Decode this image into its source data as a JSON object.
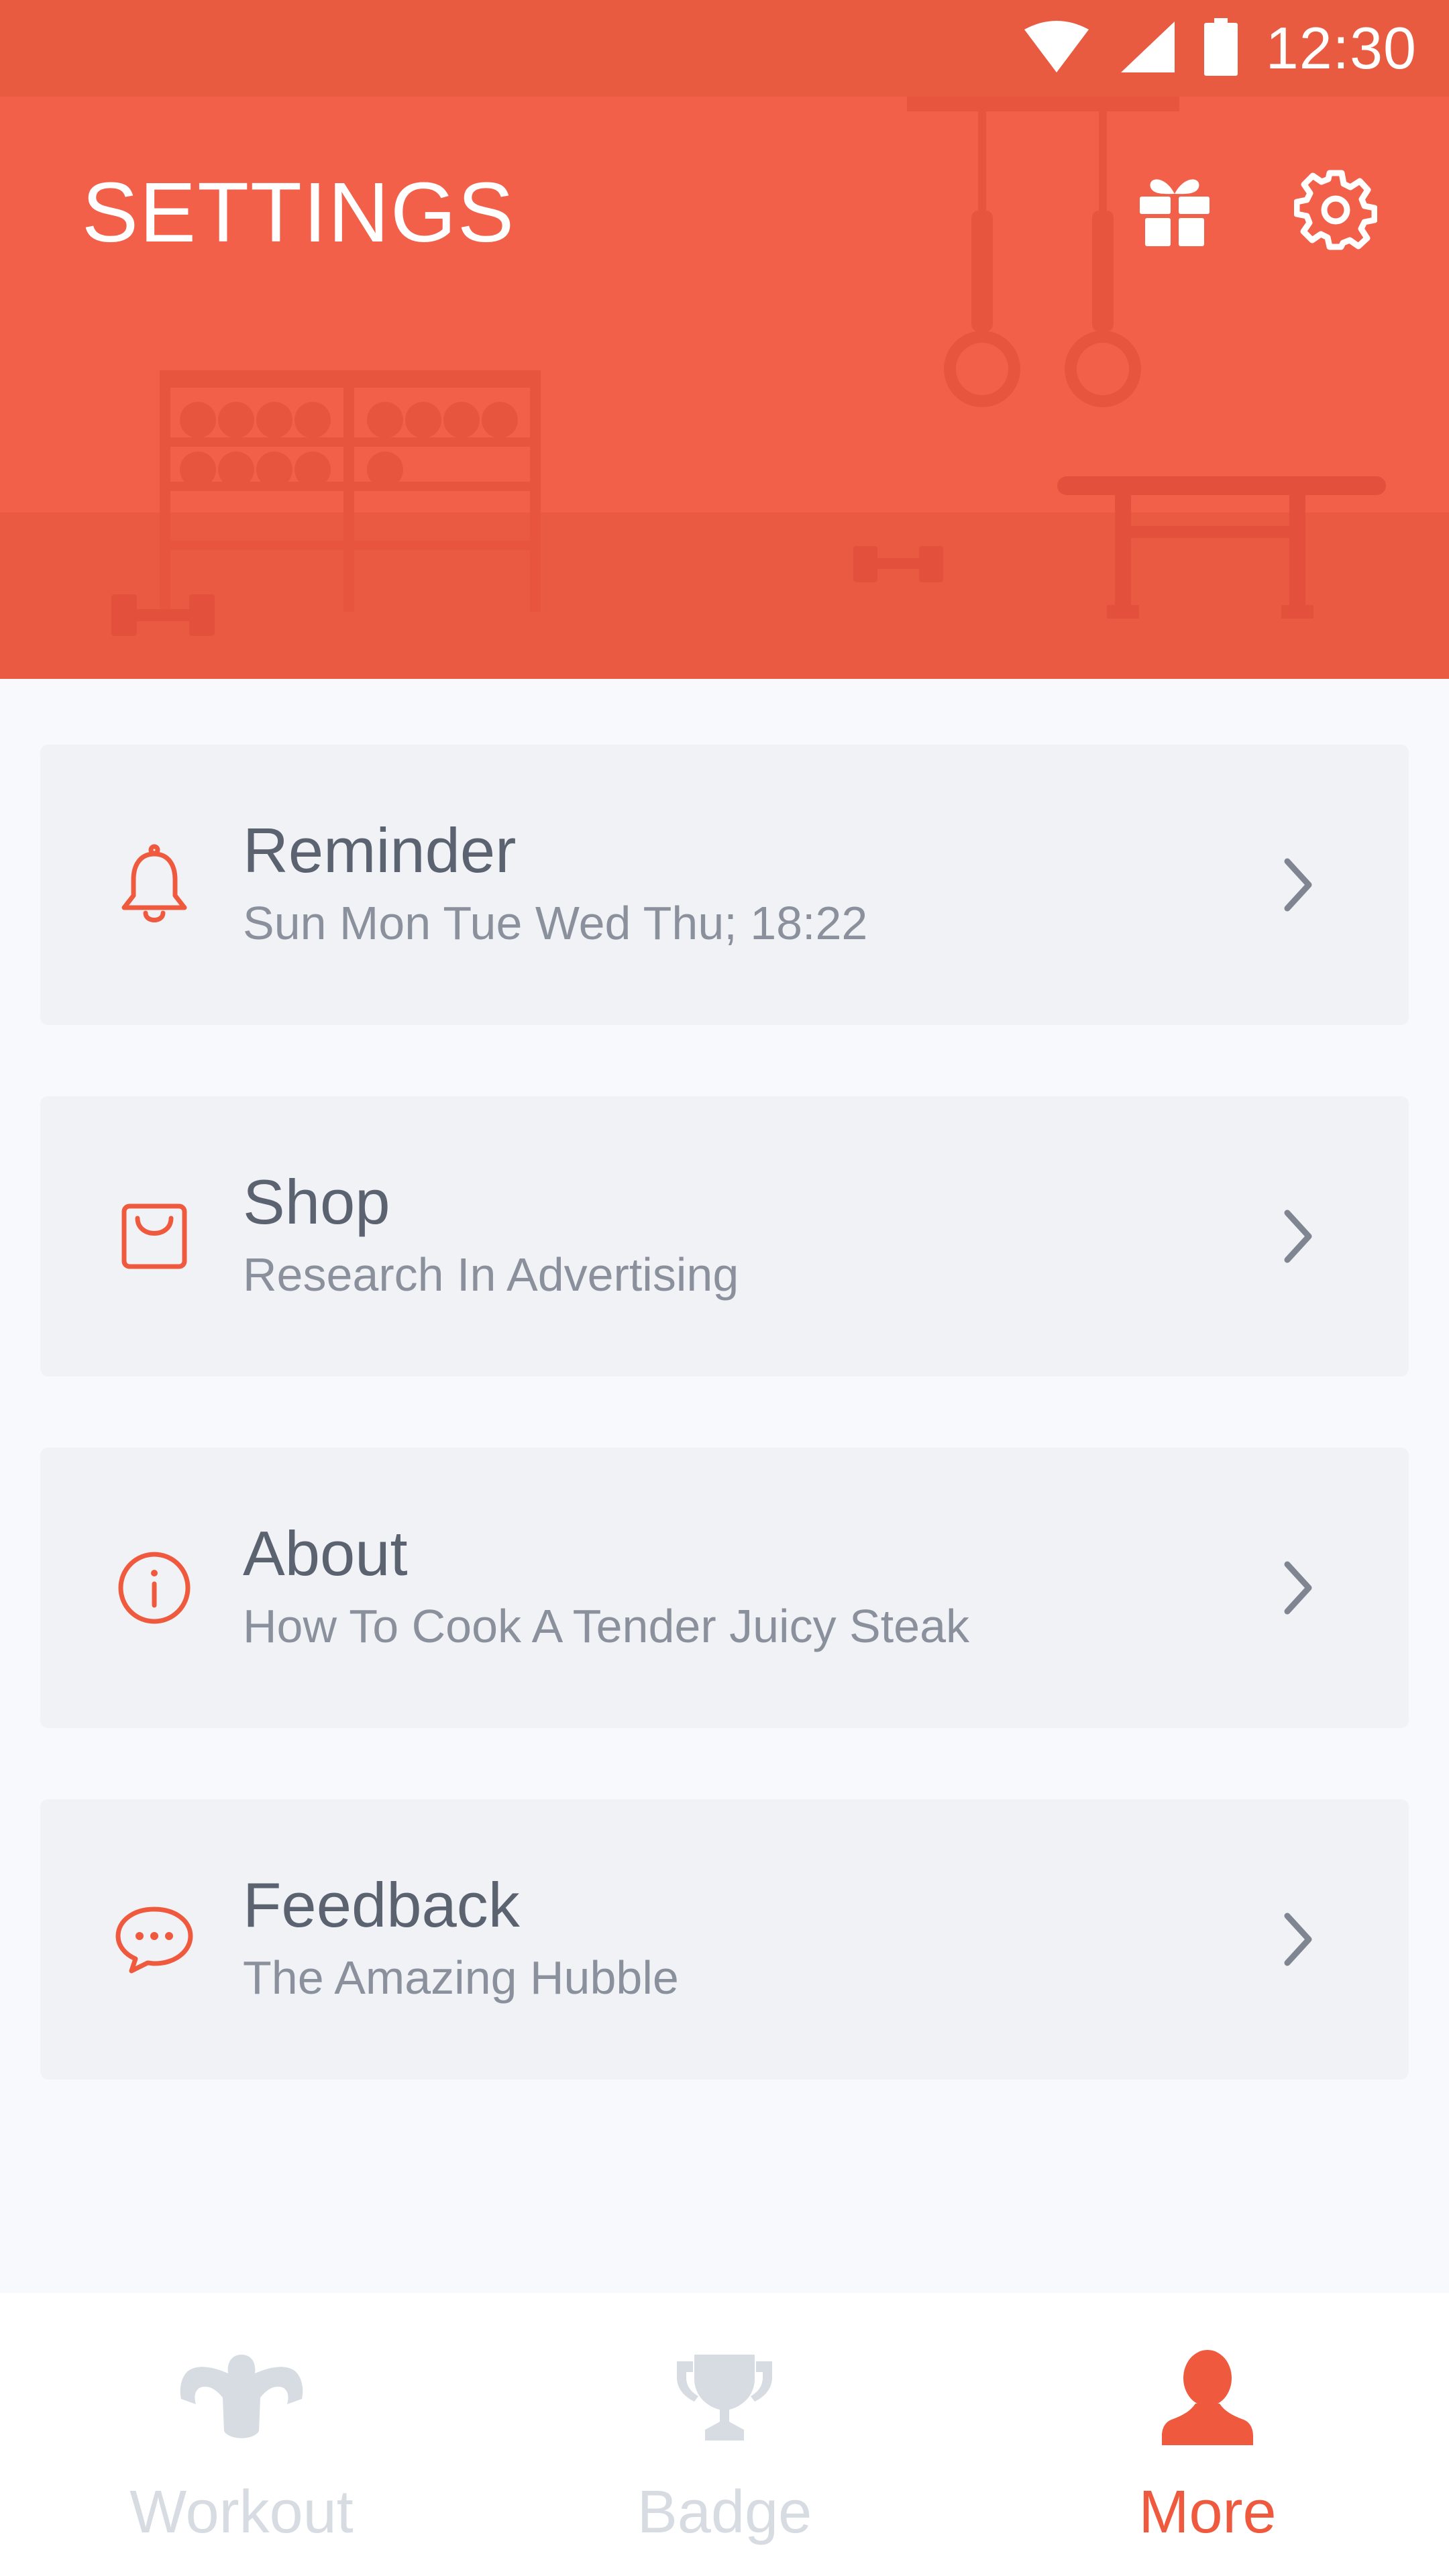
{
  "status_bar": {
    "time": "12:30",
    "icons": [
      "wifi-icon",
      "cellular-signal-icon",
      "battery-icon"
    ]
  },
  "header": {
    "title": "SETTINGS",
    "actions": [
      "gift-icon",
      "gear-icon"
    ]
  },
  "items": [
    {
      "icon": "bell-icon",
      "title": "Reminder",
      "subtitle": "Sun Mon Tue Wed Thu; 18:22"
    },
    {
      "icon": "shopping-bag-icon",
      "title": "Shop",
      "subtitle": "Research In Advertising"
    },
    {
      "icon": "info-icon",
      "title": "About",
      "subtitle": "How To Cook A Tender Juicy Steak"
    },
    {
      "icon": "chat-bubble-icon",
      "title": "Feedback",
      "subtitle": "The Amazing Hubble"
    }
  ],
  "bottom_nav": {
    "items": [
      {
        "icon": "muscle-icon",
        "label": "Workout",
        "active": false
      },
      {
        "icon": "trophy-icon",
        "label": "Badge",
        "active": false
      },
      {
        "icon": "person-icon",
        "label": "More",
        "active": true
      }
    ]
  },
  "colors": {
    "accent": "#f3604a",
    "status_bar": "#e85b41",
    "card_bg": "#f1f2f6",
    "title_text": "#5b6270",
    "subtitle_text": "#8b919c",
    "nav_inactive": "#d7dbe2",
    "nav_active": "#ef5a3f"
  }
}
